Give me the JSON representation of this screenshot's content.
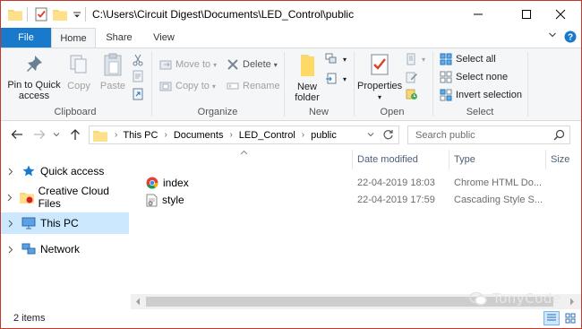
{
  "window": {
    "path_title": "C:\\Users\\Circuit Digest\\Documents\\LED_Control\\public",
    "colors": {
      "accent": "#1979ca",
      "selected": "#cce8ff",
      "ribbon_bg": "#f5f6f7"
    }
  },
  "tabs": [
    {
      "label": "File"
    },
    {
      "label": "Home"
    },
    {
      "label": "Share"
    },
    {
      "label": "View"
    }
  ],
  "ribbon": {
    "clipboard": {
      "label": "Clipboard",
      "pin": "Pin to Quick access",
      "copy": "Copy",
      "paste": "Paste"
    },
    "organize": {
      "label": "Organize",
      "move_to": "Move to",
      "copy_to": "Copy to",
      "delete": "Delete",
      "rename": "Rename"
    },
    "new": {
      "label": "New",
      "new_folder": "New folder"
    },
    "open": {
      "label": "Open",
      "properties": "Properties"
    },
    "select": {
      "label": "Select",
      "select_all": "Select all",
      "select_none": "Select none",
      "invert": "Invert selection"
    }
  },
  "address": {
    "crumbs": [
      "This PC",
      "Documents",
      "LED_Control",
      "public"
    ],
    "search_placeholder": "Search public"
  },
  "nav_pane": [
    {
      "label": "Quick access",
      "icon": "star-icon"
    },
    {
      "label": "Creative Cloud Files",
      "icon": "creative-cloud-icon"
    },
    {
      "label": "This PC",
      "icon": "computer-icon",
      "selected": true
    },
    {
      "label": "Network",
      "icon": "network-icon"
    }
  ],
  "columns": {
    "date": "Date modified",
    "type": "Type",
    "size": "Size"
  },
  "files": [
    {
      "name": "index",
      "date": "22-04-2019 18:03",
      "type": "Chrome HTML Do...",
      "icon": "chrome-icon"
    },
    {
      "name": "style",
      "date": "22-04-2019 17:59",
      "type": "Cascading Style S...",
      "icon": "css-file-icon"
    }
  ],
  "status": {
    "items": "2 items"
  },
  "watermark": "TonyCode"
}
